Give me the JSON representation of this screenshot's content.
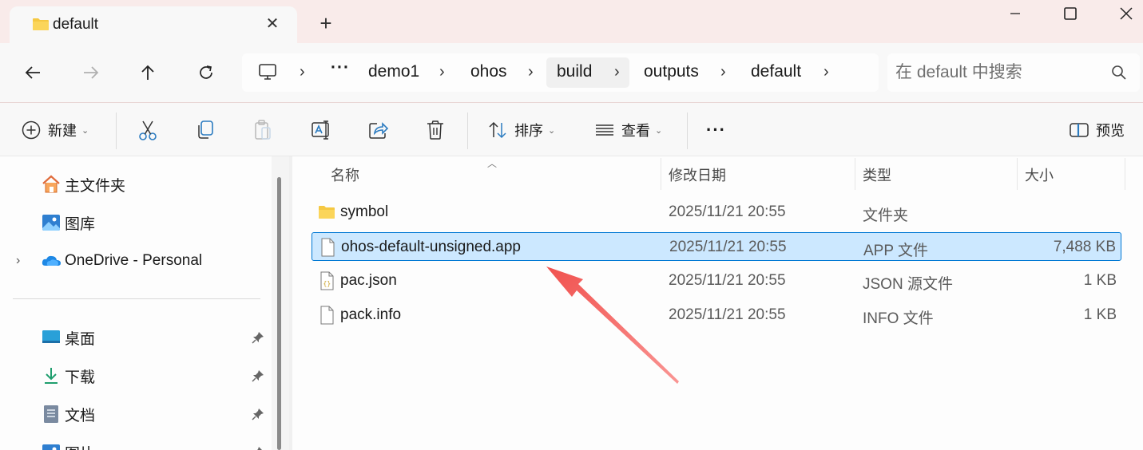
{
  "colors": {
    "title_bg": "#f9ebea",
    "surface": "#f8f8f8",
    "content_bg": "#fdfdfd",
    "selection_bg": "#cce8ff",
    "selection_border": "#0078d4",
    "folder_yellow": "#f5c842",
    "annotation_red": "#f0524f"
  },
  "tab": {
    "title": "default",
    "icon": "folder-icon",
    "close_icon": "close-icon"
  },
  "new_tab_label": "+",
  "window_controls": [
    "minimize-icon",
    "maximize-icon",
    "close-icon"
  ],
  "navigation": {
    "back": "back-arrow-icon",
    "forward": "forward-arrow-icon",
    "up": "up-arrow-icon",
    "refresh": "refresh-icon"
  },
  "breadcrumb": {
    "root_icon": "this-pc-icon",
    "overflow": "···",
    "items": [
      "demo1",
      "ohos",
      "build",
      "outputs",
      "default"
    ]
  },
  "search": {
    "placeholder": "在 default 中搜索",
    "icon": "search-icon"
  },
  "toolbar": {
    "new_label": "新建",
    "sort_label": "排序",
    "view_label": "查看",
    "more_label": "···",
    "preview_label": "预览",
    "icons": [
      "new-icon",
      "cut-icon",
      "copy-icon",
      "paste-icon",
      "rename-icon",
      "share-icon",
      "delete-icon",
      "sort-icon",
      "view-icon",
      "more-icon",
      "preview-pane-icon"
    ]
  },
  "sidebar": {
    "items": [
      {
        "label": "主文件夹",
        "icon": "home-icon"
      },
      {
        "label": "图库",
        "icon": "gallery-icon"
      },
      {
        "label": "OneDrive - Personal",
        "icon": "onedrive-icon",
        "expandable": true
      },
      {
        "label": "桌面",
        "icon": "desktop-icon",
        "pinned": true
      },
      {
        "label": "下载",
        "icon": "downloads-icon",
        "pinned": true
      },
      {
        "label": "文档",
        "icon": "documents-icon",
        "pinned": true
      },
      {
        "label": "图片",
        "icon": "pictures-icon",
        "pinned": true
      }
    ]
  },
  "file_list": {
    "columns": [
      "名称",
      "修改日期",
      "类型",
      "大小"
    ],
    "rows": [
      {
        "name": "symbol",
        "modified": "2025/11/21 20:55",
        "type": "文件夹",
        "size": "",
        "icon": "folder-icon",
        "selected": false
      },
      {
        "name": "ohos-default-unsigned.app",
        "modified": "2025/11/21 20:55",
        "type": "APP 文件",
        "size": "7,488 KB",
        "icon": "file-icon",
        "selected": true
      },
      {
        "name": "pac.json",
        "modified": "2025/11/21 20:55",
        "type": "JSON 源文件",
        "size": "1 KB",
        "icon": "json-file-icon",
        "selected": false
      },
      {
        "name": "pack.info",
        "modified": "2025/11/21 20:55",
        "type": "INFO 文件",
        "size": "1 KB",
        "icon": "file-icon",
        "selected": false
      }
    ]
  },
  "annotation": {
    "type": "arrow",
    "color": "#f0524f",
    "target": "ohos-default-unsigned.app"
  }
}
